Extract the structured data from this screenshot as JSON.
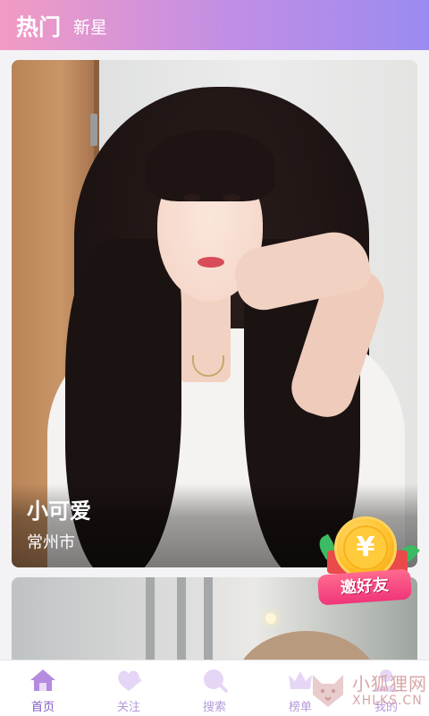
{
  "header": {
    "tabs": [
      {
        "label": "热门",
        "active": true
      },
      {
        "label": "新星",
        "active": false
      }
    ],
    "gradient": [
      "#f29bc4",
      "#9b8bf0"
    ]
  },
  "feed": {
    "cards": [
      {
        "name": "小可爱",
        "city": "常州市"
      },
      {
        "name": "",
        "city": ""
      }
    ]
  },
  "invite": {
    "coin_symbol": "¥",
    "label": "邀好友",
    "color": "#f0357a"
  },
  "bottom_nav": {
    "items": [
      {
        "label": "首页",
        "icon": "home-icon",
        "active": true
      },
      {
        "label": "关注",
        "icon": "heart-plus-icon",
        "active": false
      },
      {
        "label": "搜索",
        "icon": "search-icon",
        "active": false
      },
      {
        "label": "榜单",
        "icon": "crown-icon",
        "active": false
      },
      {
        "label": "我的",
        "icon": "profile-icon",
        "active": false
      }
    ],
    "accent": "#7e58c2"
  },
  "watermark": {
    "title": "小狐狸网",
    "domain": "XHLKS.CN"
  }
}
